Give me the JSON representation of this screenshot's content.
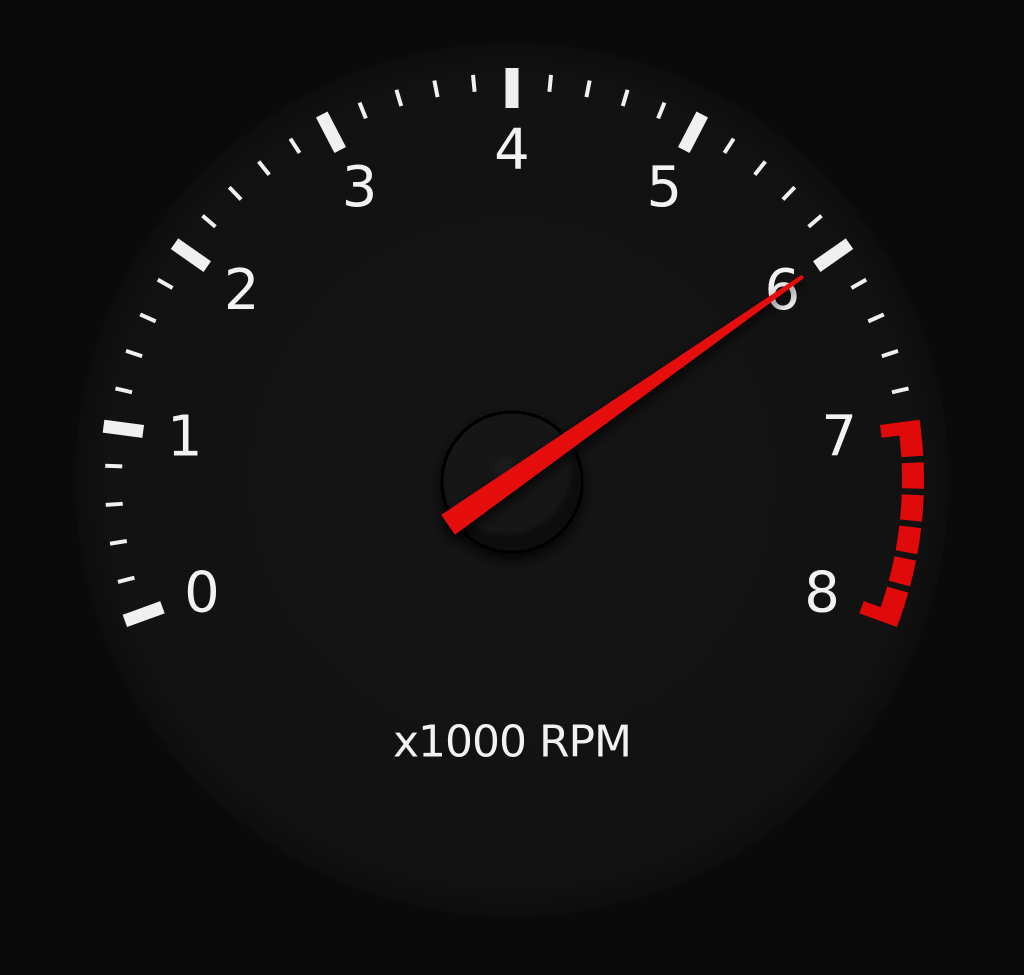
{
  "gauge": {
    "labels": [
      "0",
      "1",
      "2",
      "3",
      "4",
      "5",
      "6",
      "7",
      "8"
    ],
    "unit_label": "x1000 RPM",
    "min": 0,
    "max": 8,
    "value": 6.0,
    "minor_divisions": 5,
    "redline_start": 7,
    "colors": {
      "background": "#0a0a0a",
      "dial": "#131313",
      "tick": "#f0f0f0",
      "redline": "#e00a0a",
      "needle": "#e60b0b",
      "hub": "#161616"
    }
  }
}
